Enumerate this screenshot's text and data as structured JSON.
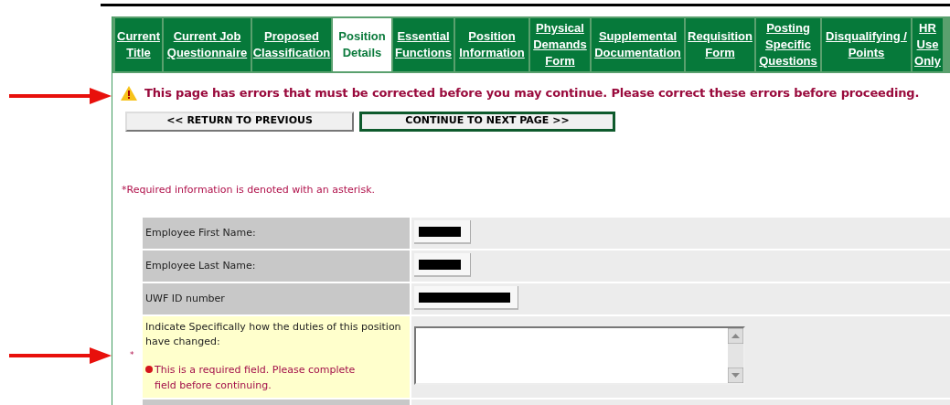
{
  "tabs": [
    {
      "label": "Current Title",
      "selected": false
    },
    {
      "label": "Current Job Questionnaire",
      "selected": false
    },
    {
      "label": "Proposed Classification",
      "selected": false
    },
    {
      "label": "Position Details",
      "selected": true
    },
    {
      "label": "Essential Functions",
      "selected": false
    },
    {
      "label": "Position Information",
      "selected": false
    },
    {
      "label": "Physical Demands Form",
      "selected": false
    },
    {
      "label": "Supplemental Documentation",
      "selected": false
    },
    {
      "label": "Requisition Form",
      "selected": false
    },
    {
      "label": "Posting Specific Questions",
      "selected": false
    },
    {
      "label": "Disqualifying / Points",
      "selected": false
    },
    {
      "label": "HR Use Only",
      "selected": false
    }
  ],
  "error_message": "This page has errors that must be corrected before you may continue. Please correct these errors before proceeding.",
  "buttons": [
    {
      "label": "<< RETURN TO PREVIOUS",
      "kind": "secondary"
    },
    {
      "label": "CONTINUE TO NEXT PAGE >>",
      "kind": "primary"
    }
  ],
  "required_note": "*Required information is denoted with an asterisk.",
  "fields": [
    {
      "label": "Employee First Name:",
      "kind": "text",
      "redacted": true,
      "required": false
    },
    {
      "label": "Employee Last Name:",
      "kind": "text",
      "redacted": true,
      "required": false
    },
    {
      "label": "UWF ID number",
      "kind": "text",
      "redacted": true,
      "required": false
    },
    {
      "label": "Indicate Specifically how the duties of this position have changed:",
      "kind": "textarea",
      "required": true,
      "required_mark": "*",
      "error": "This is a required field. Please complete field before continuing."
    }
  ]
}
